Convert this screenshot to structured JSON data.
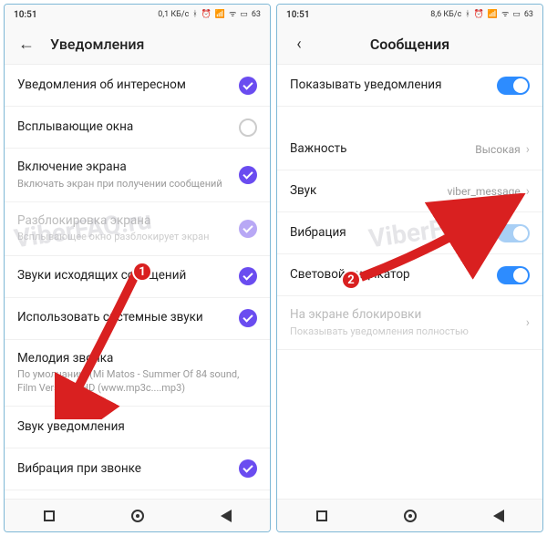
{
  "status": {
    "time": "10:51",
    "net_left": "0,1 КБ/с",
    "net_right": "8,6 КБ/с",
    "battery": "63"
  },
  "left": {
    "title": "Уведомления",
    "rows": {
      "interesting": "Уведомления об интересном",
      "popup": "Всплывающие окна",
      "screen_on_title": "Включение экрана",
      "screen_on_sub": "Включать экран при получении сообщений",
      "unlock_title": "Разблокировка экрана",
      "unlock_sub": "Всплывающее окно разблокирует экран",
      "outgoing_sounds": "Звуки исходящих сообщений",
      "system_sounds": "Использовать системные звуки",
      "ringtone_title": "Мелодия звонка",
      "ringtone_sub": "По умолчанию (Mi Matos - Summer Of 84 sound, Film Version). HD (www.mp3c....mp3)",
      "notif_sound": "Звук уведомления",
      "vibrate_call": "Вибрация при звонке"
    }
  },
  "right": {
    "title": "Сообщения",
    "rows": {
      "show_notif": "Показывать уведомления",
      "importance": "Важность",
      "importance_val": "Высокая",
      "sound": "Звук",
      "sound_val": "viber_message",
      "vibration": "Вибрация",
      "led": "Световой индикатор",
      "lock_title": "На экране блокировки",
      "lock_sub": "Показывать уведомления полностью"
    }
  },
  "badges": {
    "one": "1",
    "two": "2"
  },
  "watermark": "ViberFAQ.ru"
}
